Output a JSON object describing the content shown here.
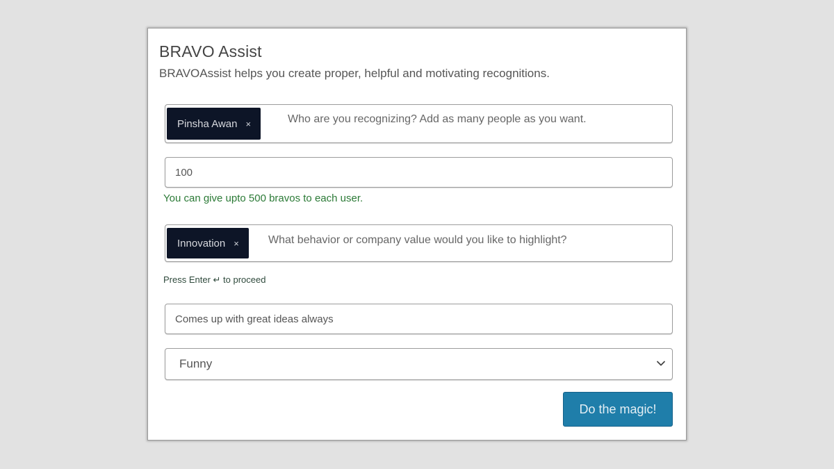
{
  "dialog": {
    "title": "BRAVO Assist",
    "subtitle": "BRAVOAssist helps you create proper, helpful and motivating recognitions."
  },
  "recipients": {
    "tags": [
      {
        "label": "Pinsha Awan",
        "remove": "×"
      }
    ],
    "placeholder": "Who are you recognizing? Add as many people as you want."
  },
  "points": {
    "value": "100",
    "hint": "You can give upto 500 bravos to each user."
  },
  "values": {
    "tags": [
      {
        "label": "Innovation",
        "remove": "×"
      }
    ],
    "placeholder": "What behavior or company value would you like to highlight?",
    "hint": "Press Enter ↵ to proceed"
  },
  "reason": {
    "value": "Comes up with great ideas always"
  },
  "tone": {
    "selected": "Funny",
    "icon": "chevron-down-icon"
  },
  "actions": {
    "submit_label": "Do the magic!"
  },
  "colors": {
    "tag_bg": "#0d1527",
    "accent": "#1f7eaa",
    "hint_green": "#2b7a36"
  }
}
